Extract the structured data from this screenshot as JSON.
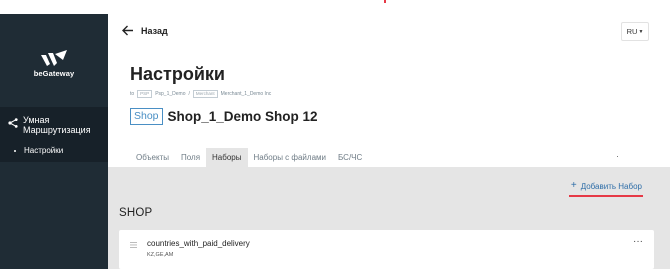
{
  "logo": {
    "text": "beGateway"
  },
  "sidebar": {
    "items": [
      {
        "label": "Умная Маршрутизация",
        "icon": "share-icon"
      },
      {
        "label": "Настройки"
      }
    ]
  },
  "header": {
    "back_label": "Назад",
    "lang": "RU"
  },
  "page": {
    "title": "Настройки",
    "breadcrumb": {
      "prefix": "to",
      "tag1": "PSP",
      "name1": "Psp_1_Demo",
      "sep": "/",
      "tag2": "Merchant",
      "name2": "Merchant_1_Demo Inc"
    },
    "shop_badge": "Shop",
    "shop_name": "Shop_1_Demo Shop 12"
  },
  "tabs": [
    {
      "label": "Объекты",
      "active": false
    },
    {
      "label": "Поля",
      "active": false
    },
    {
      "label": "Наборы",
      "active": true
    },
    {
      "label": "Наборы с файлами",
      "active": false
    },
    {
      "label": "БС/ЧС",
      "active": false
    }
  ],
  "actions": {
    "add_set_label": "Добавить Набор",
    "add_icon": "plus-icon"
  },
  "section": {
    "title": "SHOP"
  },
  "sets": [
    {
      "name": "countries_with_paid_delivery",
      "values": "KZ,GE,AM"
    }
  ],
  "colors": {
    "sidebar_bg": "#1f2c35",
    "accent": "#2f6ea8",
    "underline": "#e63946"
  }
}
